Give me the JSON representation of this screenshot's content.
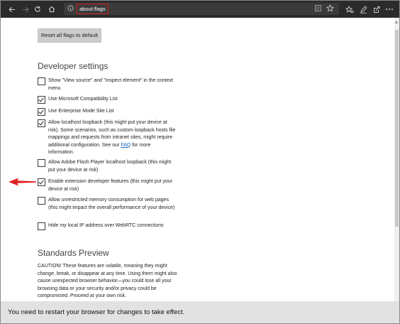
{
  "address_bar": {
    "url": "about:flags"
  },
  "reset_button_label": "Reset all flags to default",
  "developer_settings": {
    "heading": "Developer settings",
    "flags": [
      {
        "label": "Show \"View source\" and \"Inspect element\" in the context menu",
        "checked": false
      },
      {
        "label": "Use Microsoft Compatibility List",
        "checked": true
      },
      {
        "label": "Use Enterprise Mode Site List",
        "checked": true
      },
      {
        "label": "Allow localhost loopback (this might put your device at risk). Some scenarios, such as custom loopback hosts file mappings and requests from intranet sites, might require additional configuration. See our",
        "link": "FAQ",
        "label_after": " for more information.",
        "checked": true
      },
      {
        "label": "Allow Adobe Flash Player localhost loopback (this might put your device at risk)",
        "checked": false
      },
      {
        "label": "Enable extension developer features (this might put your device at risk)",
        "checked": true
      },
      {
        "label": "Allow unrestricted memory consumption for web pages (this might impact the overall performance of your device)",
        "checked": false
      },
      {
        "label": "Hide my local IP address over WebRTC connections",
        "checked": false
      }
    ]
  },
  "standards_preview": {
    "heading": "Standards Preview",
    "caution": "CAUTION! These features are volatile, meaning they might change, break, or disappear at any time. Using them might also cause unexpected browser behavior—you could lose all your browsing data or your security and/or privacy could be compromised. Proceed at your own risk."
  },
  "notification": "You need to restart your browser for changes to take effect.",
  "colors": {
    "toolbar": "#2b2b2b",
    "highlight_border": "#d21c1c",
    "arrow": "#e02020",
    "link": "#0b63b8"
  }
}
